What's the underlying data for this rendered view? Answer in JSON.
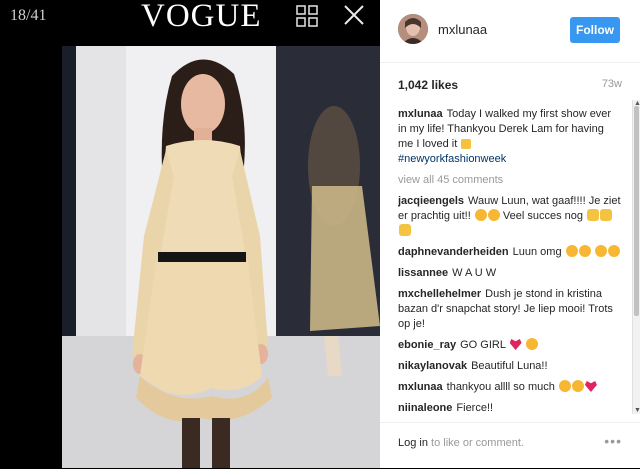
{
  "viewer": {
    "counter": "18/41",
    "logo": "VOGUE",
    "grid_icon": "grid-icon",
    "close_icon": "close-icon"
  },
  "post": {
    "username": "mxlunaa",
    "follow_label": "Follow",
    "likes": "1,042 likes",
    "age": "73w",
    "caption_user": "mxlunaa",
    "caption_text": "Today I walked my first show ever in my life! Thankyou Derek Lam for having me I loved it",
    "caption_hashtag": "#newyorkfashionweek",
    "view_all": "view all 45 comments",
    "comments": [
      {
        "user": "jacqieengels",
        "text": "Wauw Luun, wat gaaf!!!! Je ziet er prachtig uit!!",
        "text2": "Veel succes nog"
      },
      {
        "user": "daphnevanderheiden",
        "text": "Luun omg"
      },
      {
        "user": "lissannee",
        "text": "W A U W"
      },
      {
        "user": "mxchellehelmer",
        "text": "Dush je stond in kristina bazan d'r snapchat story! Je liep mooi! Trots op je!"
      },
      {
        "user": "ebonie_ray",
        "text": "GO GIRL"
      },
      {
        "user": "nikaylanovak",
        "text": "Beautiful Luna!!"
      },
      {
        "user": "mxlunaa",
        "text": "thankyou allll so much"
      },
      {
        "user": "niinaleone",
        "text": "Fierce!!"
      }
    ],
    "login_link": "Log in",
    "login_rest": " to like or comment.",
    "more_icon": "more-options-icon"
  },
  "colors": {
    "follow_blue": "#3897f0",
    "hashtag": "#003569",
    "emoji_yellow": "#f7b733",
    "heart_red": "#e0245e"
  }
}
